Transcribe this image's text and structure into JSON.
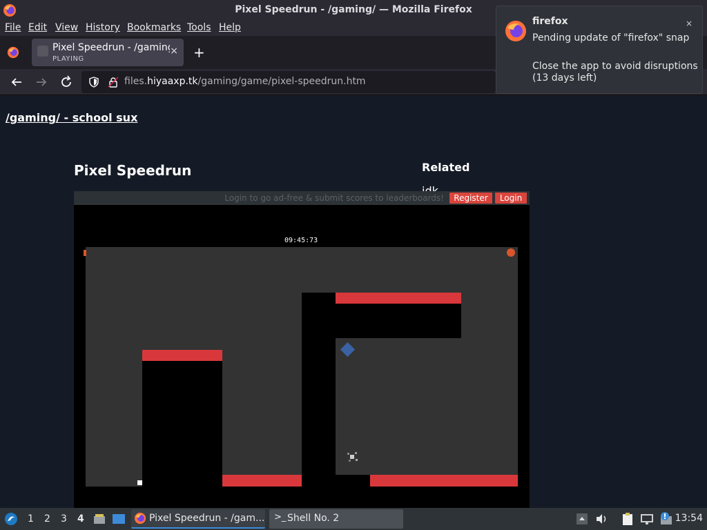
{
  "window": {
    "title": "Pixel Speedrun - /gaming/ — Mozilla Firefox"
  },
  "menu": [
    "File",
    "Edit",
    "View",
    "History",
    "Bookmarks",
    "Tools",
    "Help"
  ],
  "tab": {
    "title": "Pixel Speedrun - /gaming",
    "subtitle": "PLAYING",
    "close": "×",
    "new_tab": "+"
  },
  "nav": {
    "url_prefix": "files.",
    "url_domain": "hiyaaxp.tk",
    "url_path": "/gaming/game/pixel-speedrun.htm"
  },
  "notification": {
    "app": "firefox",
    "close": "×",
    "line1": "Pending update of \"firefox\" snap",
    "line2": "Close the app to avoid disruptions (13 days left)"
  },
  "page": {
    "site_link": "/gaming/ - school sux",
    "game_title": "Pixel Speedrun",
    "related_heading": "Related",
    "related_item": "idk"
  },
  "game": {
    "promo_text": "Login to go ad-free & submit scores to leaderboards!",
    "register_label": "Register",
    "login_label": "Login",
    "timer": "09:45:73",
    "colors": {
      "background": "#000000",
      "floor": "#333333",
      "lava": "#d8383b",
      "diamond": "#3b62a3",
      "orange": "#d9552b"
    }
  },
  "taskbar": {
    "workspaces": [
      "1",
      "2",
      "3",
      "4"
    ],
    "active_workspace": "4",
    "task_firefox": "Pixel Speedrun - /gam...",
    "task_shell": "Shell No. 2",
    "clock": "13:54"
  }
}
